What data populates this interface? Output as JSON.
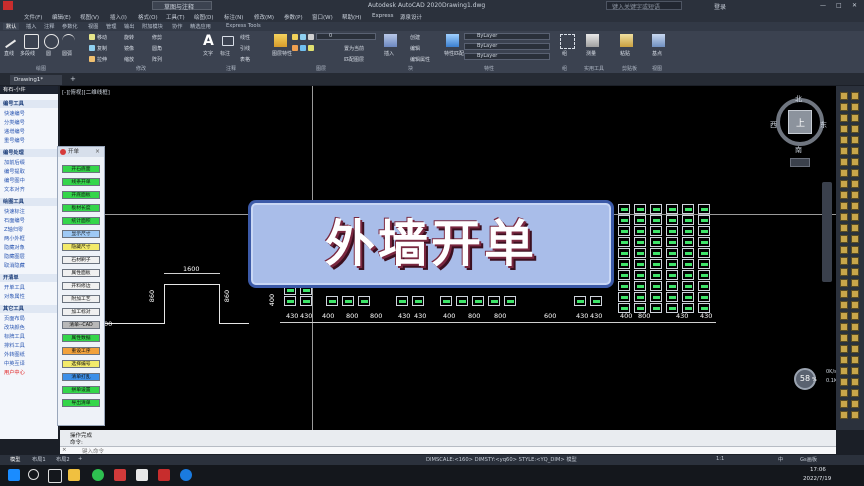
{
  "titlebar": {
    "search_placeholder": "草图与注释",
    "app_title": "Autodesk AutoCAD 2020",
    "file_name": "Drawing1.dwg",
    "search_box": "键入关键字或短语",
    "login": "登录"
  },
  "menu": [
    "文件(F)",
    "编辑(E)",
    "视图(V)",
    "插入(I)",
    "格式(O)",
    "工具(T)",
    "绘图(D)",
    "标注(N)",
    "修改(M)",
    "参数(P)",
    "窗口(W)",
    "帮助(H)",
    "Express",
    "源泉设计"
  ],
  "ribbon_tabs": [
    "默认",
    "插入",
    "注释",
    "参数化",
    "视图",
    "管理",
    "输出",
    "附加模块",
    "协作",
    "精选应用",
    "Express Tools"
  ],
  "ribbon": {
    "draw_tools": [
      "直线",
      "多段线",
      "圆",
      "圆弧"
    ],
    "modify_tools": [
      "移动",
      "旋转",
      "修剪",
      "复制",
      "镜像",
      "圆角",
      "拉伸",
      "缩放",
      "阵列"
    ],
    "annotation_tools": [
      "文字",
      "标注",
      "线性",
      "引线",
      "表格"
    ],
    "layer_tools": [
      "图层特性",
      "置为当前",
      "匹配图层"
    ],
    "layer_value": "0",
    "block_tools": [
      "插入",
      "创建",
      "编辑",
      "编辑属性"
    ],
    "props": [
      "特性匹配",
      "ByLayer",
      "ByLayer",
      "ByLayer"
    ],
    "group_tools": [
      "组",
      "测量",
      "粘贴",
      "基点"
    ],
    "panel_labels": [
      "绘图",
      "修改",
      "注释",
      "图层",
      "块",
      "特性",
      "组",
      "实用工具",
      "剪贴板",
      "视图"
    ]
  },
  "doc_tab": "Drawing1*",
  "view_label": "[-][俯视][二维线框]",
  "left_palette": {
    "header": "有石-小许",
    "sections": [
      {
        "title": "编号工具",
        "items": [
          "快速编号",
          "分类编号",
          "递增编号",
          "重号编号"
        ]
      },
      {
        "title": "编号处理",
        "items": [
          "加前后缀",
          "编号提取",
          "编号图中",
          "文本对齐"
        ]
      },
      {
        "title": "绘图工具",
        "items": [
          "快速标注",
          "石面编号",
          "Z轴归零",
          "两小外框",
          "隐藏对象",
          "隐藏图层",
          "取消隐藏"
        ]
      },
      {
        "title": "开清单",
        "items": [
          "开单工具",
          "对象属性"
        ]
      },
      {
        "title": "其它工具",
        "items": [
          "页面布局",
          "改块颜色",
          "标牌工具",
          "排料工具",
          "外转图纸",
          "中英互译",
          "用户中心"
        ]
      }
    ]
  },
  "kaidan": {
    "title": "开单",
    "buttons": [
      {
        "label": "开石底面",
        "color": "#34d64a"
      },
      {
        "label": "线条开单",
        "color": "#34d64a"
      },
      {
        "label": "开底面板",
        "color": "#34d64a"
      },
      {
        "label": "板材长度",
        "color": "#34d64a"
      },
      {
        "label": "统计面积",
        "color": "#34d64a"
      },
      {
        "label": "显示尺寸",
        "color": "#9ec9f5"
      },
      {
        "label": "隐藏尺寸",
        "color": "#f3ea6a"
      },
      {
        "label": "石材刷子",
        "color": "#f0f0f0"
      },
      {
        "label": "属性面板",
        "color": "#f0f0f0"
      },
      {
        "label": "开料修边",
        "color": "#f0f0f0"
      },
      {
        "label": "附加工艺",
        "color": "#f0f0f0"
      },
      {
        "label": "加工标对",
        "color": "#f0f0f0"
      },
      {
        "label": "清单--CAD",
        "color": "#b8b8b8"
      },
      {
        "label": "属性数据",
        "color": "#34d64a"
      },
      {
        "label": "重设工序",
        "color": "#f2a23c"
      },
      {
        "label": "选择编号",
        "color": "#f3ea6a"
      },
      {
        "label": "清单打乱",
        "color": "#3c8fe8"
      },
      {
        "label": "拼单设置",
        "color": "#34d64a"
      },
      {
        "label": "导出清单",
        "color": "#34d64a"
      }
    ]
  },
  "drawing": {
    "dims_top": [
      "1600"
    ],
    "dims_side": [
      "860",
      "860",
      "400"
    ],
    "dims_bottom": [
      "430",
      "430",
      "400",
      "800",
      "800",
      "400",
      "430",
      "430",
      "400",
      "800",
      "800",
      "600",
      "430",
      "430",
      "400",
      "800",
      "430",
      "430"
    ],
    "dim_left_fragment": "00"
  },
  "banner_title": "外墙开单",
  "viewcube": {
    "north": "北",
    "south": "南",
    "east": "东",
    "west": "西",
    "center": "上",
    "wcs": "WCS"
  },
  "speed": {
    "value": "58",
    "unit": "%",
    "up": "0K/s",
    "down": "0.1K/s"
  },
  "command": {
    "line1": "操作完成",
    "line2": "命令:",
    "input_placeholder": "键入命令"
  },
  "status_tabs": [
    "模型",
    "布局1",
    "布局2"
  ],
  "status_info": "DIMSCALE:<160> DIMSTY:<yq60> STYLE:<YQ_DIM>  模型",
  "status_right": "1:1",
  "clock": {
    "time": "17:06",
    "date": "2022/7/19"
  },
  "status_lang": "中",
  "status_extra": "Gs画板"
}
